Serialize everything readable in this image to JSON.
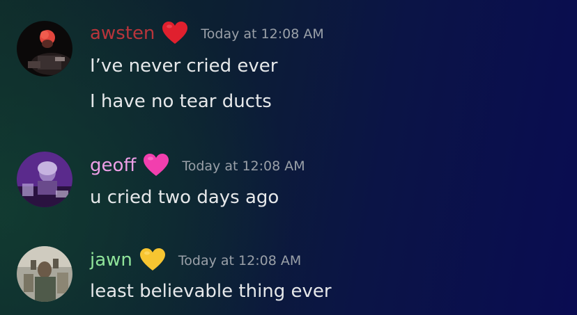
{
  "messages": [
    {
      "username": "awsten",
      "username_color": "#b8353b",
      "heart_emoji": "red-heart",
      "heart_color": "#e0202e",
      "timestamp": "Today at 12:08 AM",
      "lines": [
        "I’ve never cried ever",
        "I have no tear ducts"
      ]
    },
    {
      "username": "geoff",
      "username_color": "#ee9fe7",
      "heart_emoji": "pink-heart",
      "heart_color": "#f23fae",
      "timestamp": "Today at 12:08 AM",
      "lines": [
        "u cried two days ago"
      ]
    },
    {
      "username": "jawn",
      "username_color": "#8fe39a",
      "heart_emoji": "yellow-heart",
      "heart_color": "#f7c531",
      "timestamp": "Today at 12:08 AM",
      "lines": [
        "least believable thing ever"
      ]
    }
  ]
}
